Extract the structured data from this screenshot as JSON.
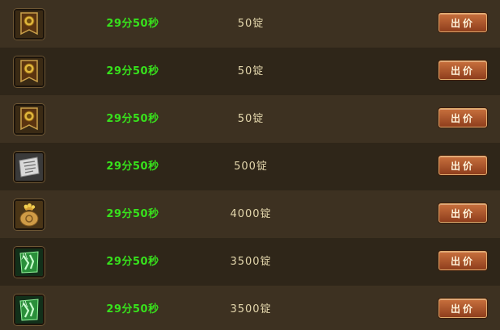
{
  "auction": {
    "rows": [
      {
        "icon": "banner-token-icon",
        "time": "29分50秒",
        "price": "50锭",
        "bid_label": "出价"
      },
      {
        "icon": "banner-token-icon",
        "time": "29分50秒",
        "price": "50锭",
        "bid_label": "出价"
      },
      {
        "icon": "banner-token-icon",
        "time": "29分50秒",
        "price": "50锭",
        "bid_label": "出价"
      },
      {
        "icon": "scroll-icon",
        "time": "29分50秒",
        "price": "500锭",
        "bid_label": "出价"
      },
      {
        "icon": "gold-bag-icon",
        "time": "29分50秒",
        "price": "4000锭",
        "bid_label": "出价"
      },
      {
        "icon": "jade-card-icon",
        "time": "29分50秒",
        "price": "3500锭",
        "bid_label": "出价"
      },
      {
        "icon": "jade-card-icon",
        "time": "29分50秒",
        "price": "3500锭",
        "bid_label": "出价"
      }
    ]
  },
  "colors": {
    "time_text": "#37e21c",
    "price_text": "#e3d6ac",
    "row_light": "#3d3121",
    "row_dark": "#2f2619",
    "button": "#b25a2e"
  }
}
